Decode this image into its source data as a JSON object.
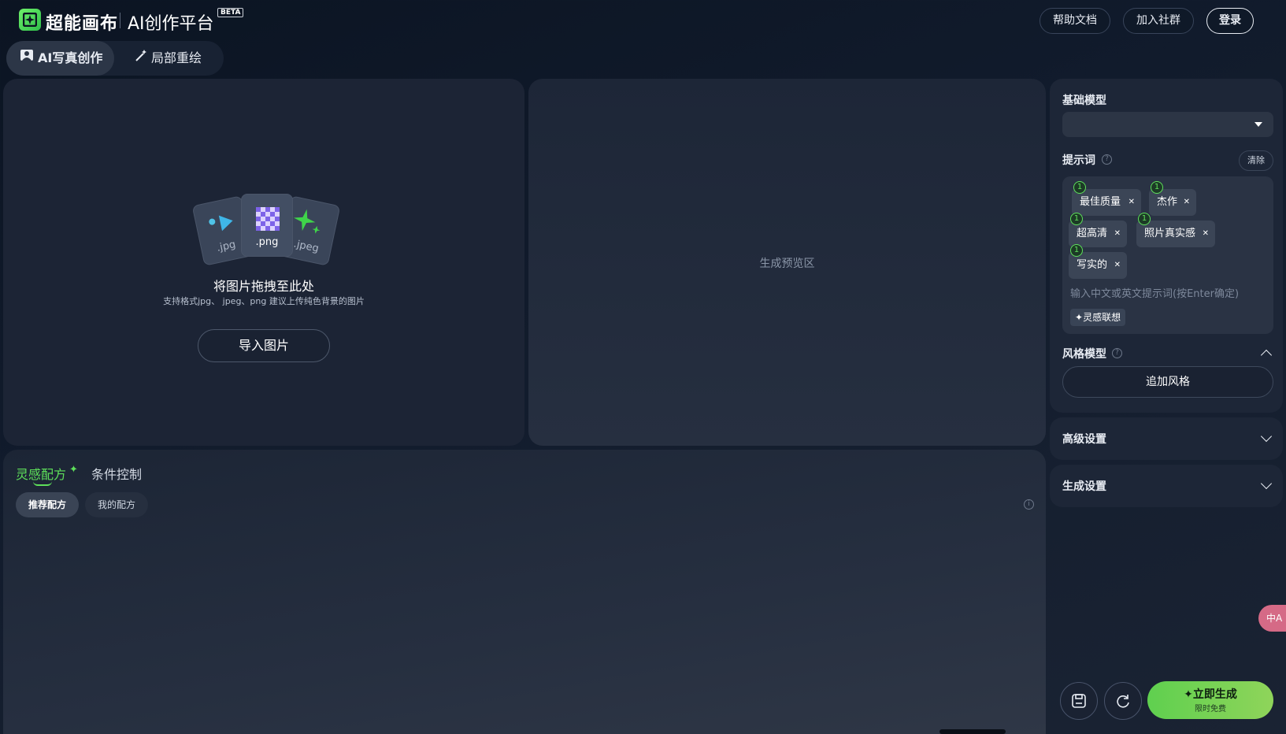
{
  "header": {
    "logo_text": "超能画布",
    "platform_title": "AI创作平台",
    "beta": "BETA",
    "help_label": "帮助文档",
    "community_label": "加入社群",
    "login_label": "登录"
  },
  "mode_tabs": [
    {
      "label": "AI写真创作",
      "active": true
    },
    {
      "label": "局部重绘",
      "active": false
    }
  ],
  "upload": {
    "file_types": [
      ".jpg",
      ".png",
      ".jpeg"
    ],
    "title": "将图片拖拽至此处",
    "subtitle": "支持格式jpg、 jpeg、png 建议上传纯色背景的图片",
    "import_label": "导入图片"
  },
  "preview": {
    "label": "生成预览区"
  },
  "bottom": {
    "tabs": [
      {
        "label": "灵感配方",
        "active": true
      },
      {
        "label": "条件控制",
        "active": false
      }
    ],
    "subtabs": [
      {
        "label": "推荐配方",
        "active": true
      },
      {
        "label": "我的配方",
        "active": false
      }
    ]
  },
  "sidebar": {
    "base_model_label": "基础模型",
    "base_model_value": "",
    "prompt_label": "提示词",
    "clear_label": "清除",
    "tags": [
      {
        "weight": "1",
        "label": "最佳质量"
      },
      {
        "weight": "1",
        "label": "杰作"
      },
      {
        "weight": "1",
        "label": "超高清"
      },
      {
        "weight": "1",
        "label": "照片真实感"
      },
      {
        "weight": "1",
        "label": "写实的"
      }
    ],
    "prompt_placeholder": "输入中文或英文提示词(按Enter确定)",
    "inspire_label": "灵感联想",
    "style_model_label": "风格模型",
    "add_style_label": "追加风格",
    "advanced_label": "高级设置",
    "generate_settings_label": "生成设置",
    "generate_label": "立即生成",
    "generate_sub": "限时免费"
  },
  "floating": {
    "translate_label": "中A"
  },
  "colors": {
    "accent": "#5ee05a",
    "background": "#0b1422",
    "panel": "#1c2435",
    "generate_gradient_start": "#5fd04f",
    "generate_gradient_end": "#8fd45a"
  }
}
